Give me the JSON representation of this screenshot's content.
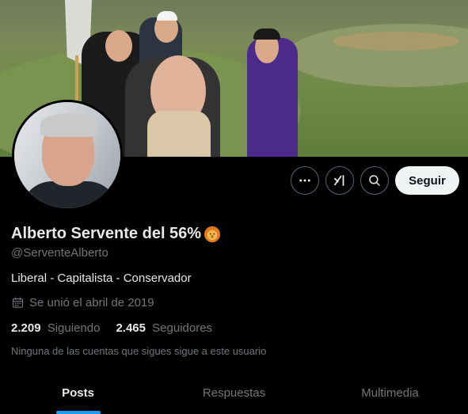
{
  "profile": {
    "name": "Alberto Servente del 56%",
    "handle": "@ServenteAlberto",
    "bio": "Liberal - Capitalista - Conservador",
    "joined": "Se unió el abril de 2019",
    "following_count": "2.209",
    "following_label": "Siguiendo",
    "followers_count": "2.465",
    "followers_label": "Seguidores",
    "mutual_note": "Ninguna de las cuentas que sigues sigue a este usuario"
  },
  "actions": {
    "more_icon": "more-horizontal-icon",
    "grok_icon": "grok-icon",
    "search_icon": "search-icon",
    "follow_label": "Seguir"
  },
  "tabs": [
    {
      "label": "Posts",
      "active": true
    },
    {
      "label": "Respuestas",
      "active": false
    },
    {
      "label": "Multimedia",
      "active": false
    }
  ],
  "colors": {
    "background": "#000000",
    "accent": "#1d9bf0",
    "secondary_text": "#71767b",
    "follow_button": "#eff3f4"
  }
}
